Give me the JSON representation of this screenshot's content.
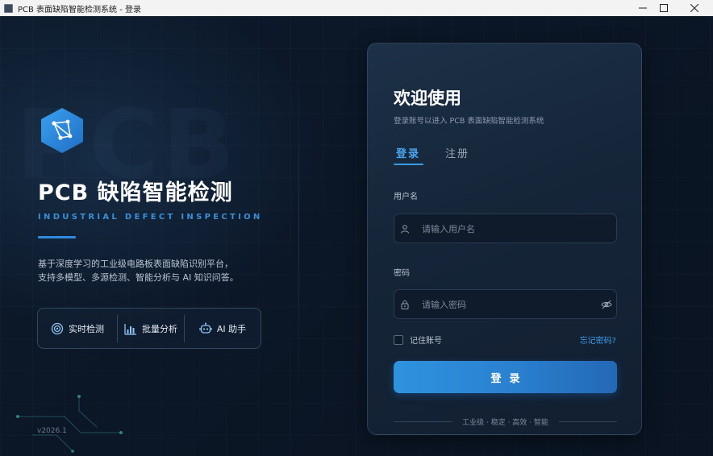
{
  "window": {
    "title": "PCB 表面缺陷智能检测系统 - 登录",
    "controls": [
      "minimize-icon",
      "maximize-icon",
      "close-icon"
    ]
  },
  "brand": {
    "watermark": "PCB",
    "title": "PCB 缺陷智能检测",
    "subtitle": "INDUSTRIAL DEFECT INSPECTION",
    "description_line1": "基于深度学习的工业级电路板表面缺陷识别平台，",
    "description_line2": "支持多模型、多源检测、智能分析与 AI 知识问答。",
    "version": "v2026.1",
    "accent_color": "#2f8ae0"
  },
  "features": [
    {
      "icon": "target-icon",
      "label": "实时检测"
    },
    {
      "icon": "bar-chart-icon",
      "label": "批量分析"
    },
    {
      "icon": "robot-icon",
      "label": "AI 助手"
    }
  ],
  "login": {
    "title": "欢迎使用",
    "subtitle": "登录账号以进入 PCB 表面缺陷智能检测系统",
    "tabs": {
      "login": "登录",
      "register": "注册",
      "active": "login"
    },
    "username_label": "用户名",
    "username_placeholder": "请输入用户名",
    "password_label": "密码",
    "password_placeholder": "请输入密码",
    "remember_label": "记住账号",
    "remember_checked": false,
    "forgot_label": "忘记密码?",
    "submit_label": "登录",
    "footer": "工业级 · 稳定 · 高效 · 智能",
    "button_color": "#2e93df"
  }
}
